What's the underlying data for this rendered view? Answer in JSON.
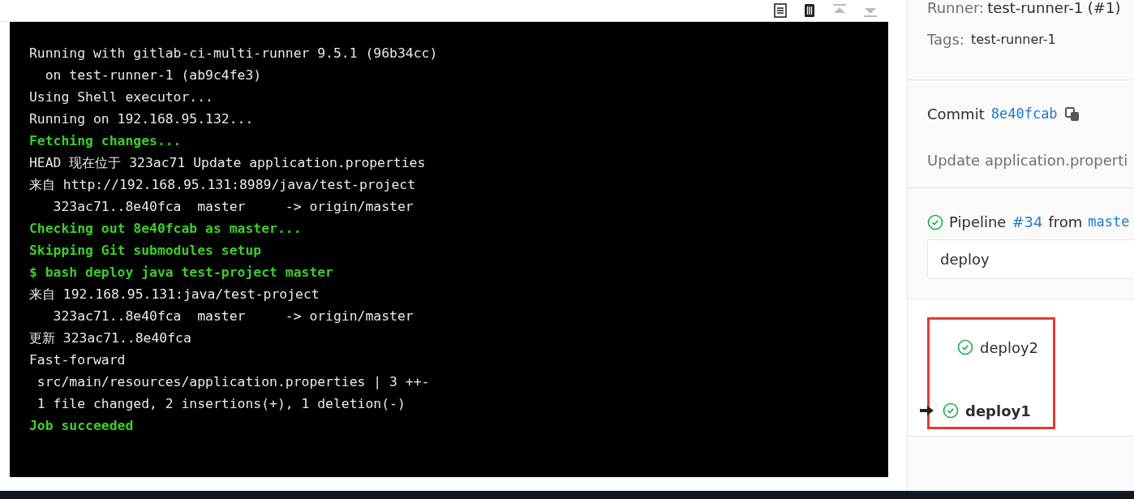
{
  "log": {
    "lines": [
      {
        "text": "Running with gitlab-ci-multi-runner 9.5.1 (96b34cc)",
        "kind": "normal"
      },
      {
        "text": "  on test-runner-1 (ab9c4fe3)",
        "kind": "normal"
      },
      {
        "text": "Using Shell executor...",
        "kind": "normal"
      },
      {
        "text": "Running on 192.168.95.132...",
        "kind": "normal"
      },
      {
        "text": "Fetching changes...",
        "kind": "success"
      },
      {
        "text": "HEAD 现在位于 323ac71 Update application.properties",
        "kind": "normal"
      },
      {
        "text": "来自 http://192.168.95.131:8989/java/test-project",
        "kind": "normal"
      },
      {
        "text": "   323ac71..8e40fca  master     -> origin/master",
        "kind": "normal"
      },
      {
        "text": "Checking out 8e40fcab as master...",
        "kind": "success"
      },
      {
        "text": "Skipping Git submodules setup",
        "kind": "success"
      },
      {
        "text": "$ bash deploy java test-project master",
        "kind": "success"
      },
      {
        "text": "来自 192.168.95.131:java/test-project",
        "kind": "normal"
      },
      {
        "text": "   323ac71..8e40fca  master     -> origin/master",
        "kind": "normal"
      },
      {
        "text": "更新 323ac71..8e40fca",
        "kind": "normal"
      },
      {
        "text": "Fast-forward",
        "kind": "normal"
      },
      {
        "text": " src/main/resources/application.properties | 3 ++-",
        "kind": "normal"
      },
      {
        "text": " 1 file changed, 2 insertions(+), 1 deletion(-)",
        "kind": "normal"
      },
      {
        "text": "Job succeeded",
        "kind": "success"
      }
    ]
  },
  "sidebar": {
    "runner_label": "Runner:",
    "runner": "test-runner-1 (#1)",
    "tags_label": "Tags:",
    "tags": [
      "test-runner-1"
    ],
    "commit_label": "Commit",
    "commit_sha": "8e40fcab",
    "commit_message": "Update application.properti",
    "pipeline_label": "Pipeline",
    "pipeline_id": "#34",
    "pipeline_from": "from",
    "pipeline_ref": "maste",
    "stage": "deploy",
    "jobs": [
      {
        "name": "deploy2",
        "selected": false
      },
      {
        "name": "deploy1",
        "selected": true
      }
    ]
  }
}
